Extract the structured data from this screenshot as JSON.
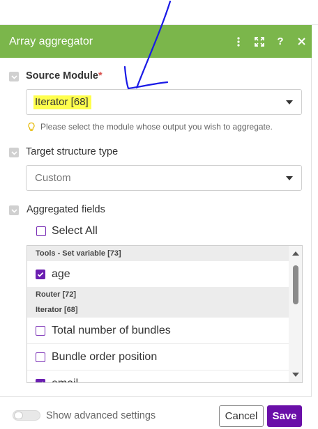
{
  "module": {
    "title": "Array aggregator",
    "header_icons": [
      "more-vertical-icon",
      "expand-icon",
      "help-icon",
      "close-icon"
    ]
  },
  "source_module": {
    "label": "Source Module",
    "required_mark": "*",
    "value": "Iterator [68]",
    "hint": "Please select the module whose output you wish to aggregate.",
    "highlight_color": "#ffff4d"
  },
  "target_structure": {
    "label": "Target structure type",
    "value": "Custom"
  },
  "aggregated_fields": {
    "label": "Aggregated fields",
    "select_all_label": "Select All",
    "groups": [
      {
        "header": "Tools - Set variable [73]"
      },
      {
        "header": "Router [72]"
      },
      {
        "header": "Iterator [68]"
      }
    ],
    "items": [
      {
        "label": "age",
        "checked": true
      },
      {
        "label": "Total number of bundles",
        "checked": false
      },
      {
        "label": "Bundle order position",
        "checked": false
      },
      {
        "label": "email",
        "checked": true
      }
    ]
  },
  "footer": {
    "advanced_label": "Show advanced settings",
    "advanced_enabled": false,
    "cancel_label": "Cancel",
    "save_label": "Save"
  },
  "colors": {
    "header_green": "#7bb64b",
    "accent_purple": "#6a0fa8",
    "annotation_blue": "#1a1ae6"
  }
}
